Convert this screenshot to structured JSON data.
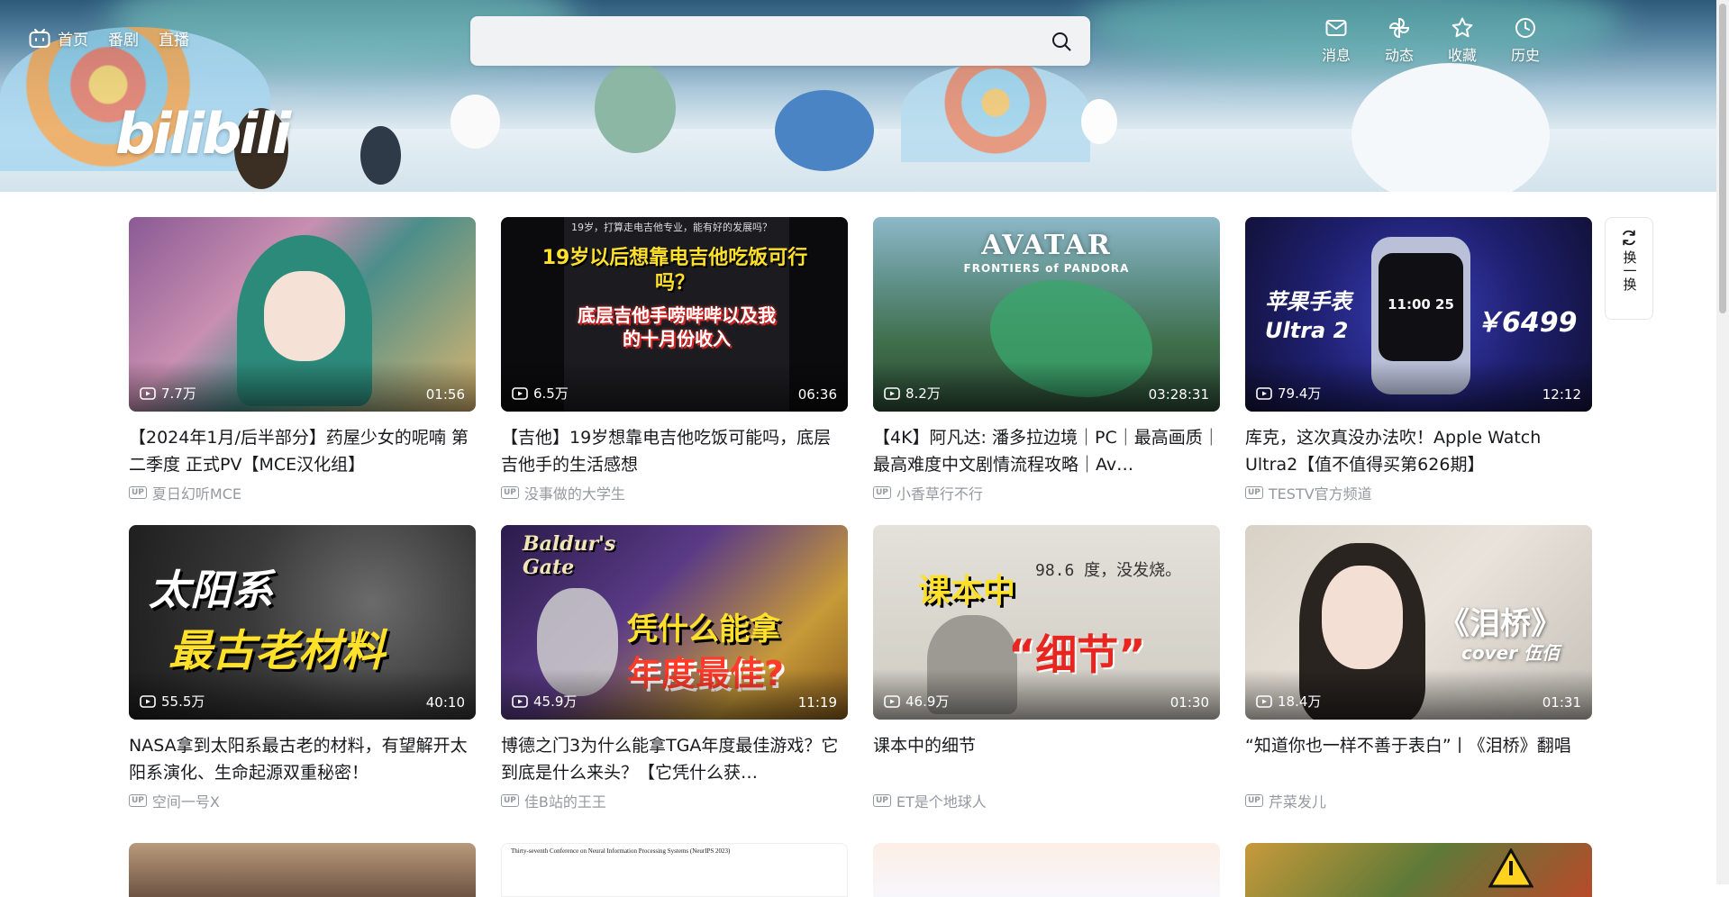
{
  "header": {
    "nav_left": [
      {
        "label": "首页",
        "icon": "tv-icon"
      },
      {
        "label": "番剧"
      },
      {
        "label": "直播"
      }
    ],
    "logo_text": "bilibili",
    "search": {
      "placeholder": "",
      "value": ""
    },
    "nav_right": [
      {
        "label": "消息",
        "icon": "mail-icon"
      },
      {
        "label": "动态",
        "icon": "pinwheel-icon"
      },
      {
        "label": "收藏",
        "icon": "star-icon"
      },
      {
        "label": "历史",
        "icon": "clock-icon"
      }
    ]
  },
  "refresh_button": {
    "label": "换一换"
  },
  "videos": [
    {
      "title": "【2024年1月/后半部分】药屋少女的呢喃 第二季度 正式PV【MCE汉化组】",
      "views": "7.7万",
      "duration": "01:56",
      "uploader": "夏日幻听MCE",
      "thumb_text": ""
    },
    {
      "title": "【吉他】19岁想靠电吉他吃饭可能吗，底层吉他手的生活感想",
      "views": "6.5万",
      "duration": "06:36",
      "uploader": "没事做的大学生",
      "thumb_text": "19岁以后想靠电吉他吃饭可行吗？",
      "thumb_text2": "底层吉他手唠哔哔以及我的十月份收入",
      "thumb_small": "19岁，打算走电吉他专业，能有好的发展吗？"
    },
    {
      "title": "【4K】阿凡达: 潘多拉边境｜PC｜最高画质｜最高难度中文剧情流程攻略｜Av…",
      "views": "8.2万",
      "duration": "03:28:31",
      "uploader": "小香草行不行",
      "thumb_text": "AVATAR",
      "thumb_text2": "FRONTIERS of PANDORA"
    },
    {
      "title": "库克，这次真没办法吹！Apple Watch Ultra2【值不值得买第626期】",
      "views": "79.4万",
      "duration": "12:12",
      "uploader": "TESTV官方频道",
      "thumb_text": "苹果手表 Ultra 2",
      "thumb_text2": "￥6499",
      "thumb_small": "11:00 25"
    },
    {
      "title": "NASA拿到太阳系最古老的材料，有望解开太阳系演化、生命起源双重秘密！",
      "views": "55.5万",
      "duration": "40:10",
      "uploader": "空间一号X",
      "thumb_text": "太阳系",
      "thumb_text2": "最古老材料"
    },
    {
      "title": "博德之门3为什么能拿TGA年度最佳游戏？它到底是什么来头？【它凭什么获…",
      "views": "45.9万",
      "duration": "11:19",
      "uploader": "佳B站的王王",
      "thumb_text": "凭什么能拿",
      "thumb_text2": "年度最佳?",
      "thumb_small": "Baldur's Gate"
    },
    {
      "title": "课本中的细节",
      "views": "46.9万",
      "duration": "01:30",
      "uploader": "ET是个地球人",
      "thumb_text": "课本中",
      "thumb_text2": "“细节”",
      "thumb_small": "98.6 度，没发烧。"
    },
    {
      "title": "“知道你也一样不善于表白”丨《泪桥》翻唱",
      "views": "18.4万",
      "duration": "01:31",
      "uploader": "芹菜发儿",
      "thumb_text": "《泪桥》",
      "thumb_text2": "cover 伍佰"
    }
  ],
  "row3_snippet": "Thirty-seventh Conference on Neural Information Processing Systems (NeurIPS 2023)"
}
